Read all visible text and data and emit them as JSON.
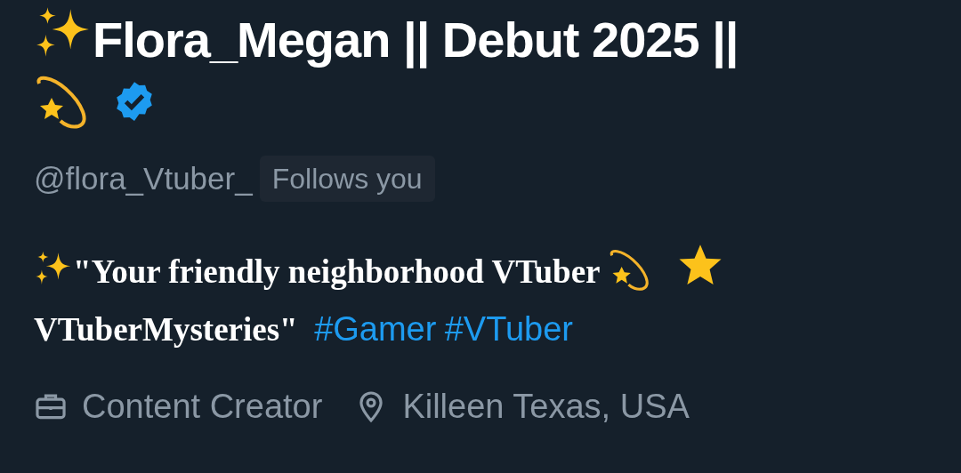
{
  "profile": {
    "display_name": "Flora_Megan || Debut 2025 ||",
    "verified": true,
    "handle": "@flora_Vtuber_",
    "follows_you": "Follows you",
    "bio": {
      "text_before": "\"Your friendly neighborhood VTuber",
      "text_after": "VTuberMysteries\"",
      "hashtags": [
        "#Gamer",
        "#VTuber"
      ]
    },
    "meta": [
      {
        "kind": "profession",
        "text": "Content Creator"
      },
      {
        "kind": "location",
        "text": "Killeen Texas, USA"
      }
    ]
  }
}
